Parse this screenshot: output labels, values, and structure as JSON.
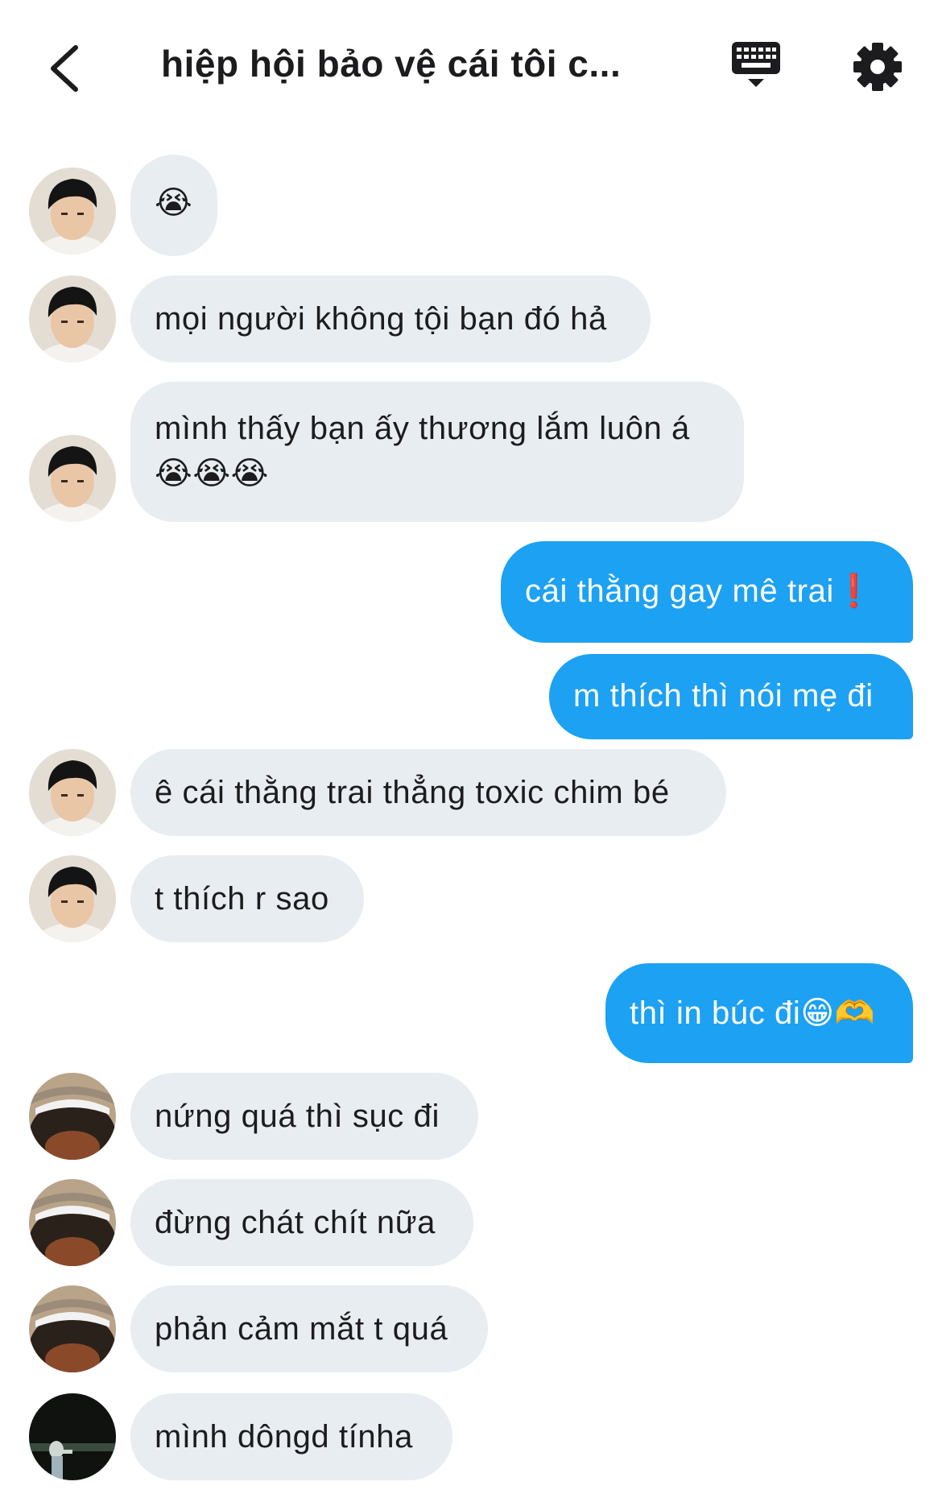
{
  "header": {
    "title": "hiệp hội bảo vệ cái tôi c...",
    "back_icon": "chevron-left-icon",
    "keyboard_icon": "keyboard-icon",
    "settings_icon": "gear-icon"
  },
  "colors": {
    "incoming_bubble": "#e8edf2",
    "outgoing_bubble": "#1da1f2",
    "text": "#1c1c1e"
  },
  "messages": [
    {
      "direction": "in",
      "sender_avatar": "avatar-boy",
      "text": "😭"
    },
    {
      "direction": "in",
      "sender_avatar": "avatar-boy",
      "text": "mọi người không tội bạn đó hả"
    },
    {
      "direction": "in",
      "sender_avatar": "avatar-boy",
      "text": "mình thấy bạn ấy thương lắm luôn á\n😭😭😭"
    },
    {
      "direction": "out",
      "text": "cái thằng gay mê trai❗"
    },
    {
      "direction": "out",
      "text": "m thích thì nói mẹ đi"
    },
    {
      "direction": "in",
      "sender_avatar": "avatar-boy",
      "text": "ê cái thằng trai thẳng toxic chim bé"
    },
    {
      "direction": "in",
      "sender_avatar": "avatar-boy",
      "text": "t thích r sao"
    },
    {
      "direction": "out",
      "text": "thì in búc đi😁🫶"
    },
    {
      "direction": "in",
      "sender_avatar": "avatar-hat",
      "text": "nứng quá thì sục đi"
    },
    {
      "direction": "in",
      "sender_avatar": "avatar-hat",
      "text": "đừng chát chít nữa"
    },
    {
      "direction": "in",
      "sender_avatar": "avatar-hat",
      "text": "phản cảm mắt t quá"
    },
    {
      "direction": "in",
      "sender_avatar": "avatar-dark",
      "text": "mình dôngd tínha"
    }
  ]
}
